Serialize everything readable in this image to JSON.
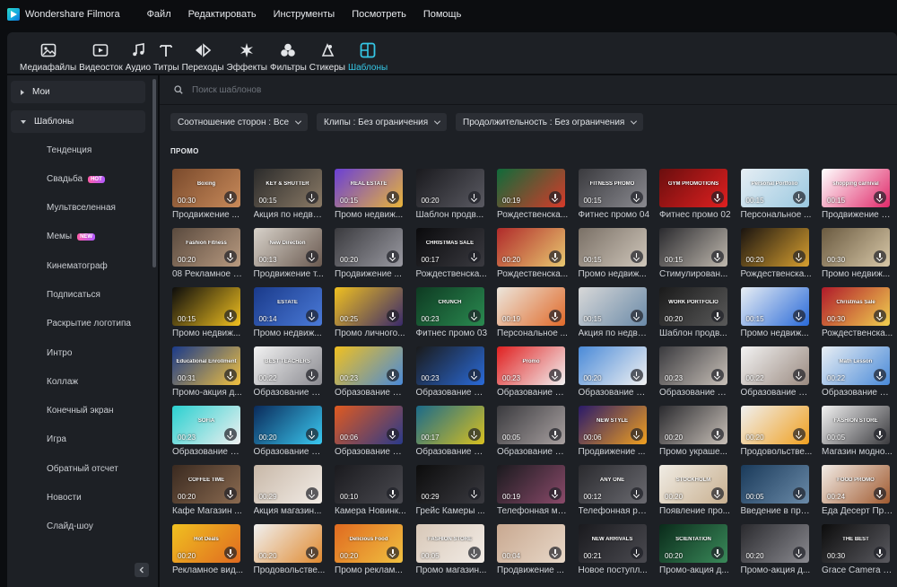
{
  "app": {
    "title": "Wondershare Filmora",
    "menu": [
      "Файл",
      "Редактировать",
      "Инструменты",
      "Посмотреть",
      "Помощь"
    ]
  },
  "toolbar": {
    "items": [
      {
        "label": "Медиафайлы",
        "icon": "media-icon"
      },
      {
        "label": "Видеосток",
        "icon": "stock-video-icon"
      },
      {
        "label": "Аудио",
        "icon": "music-note-icon"
      },
      {
        "label": "Титры",
        "icon": "titles-icon"
      },
      {
        "label": "Переходы",
        "icon": "transitions-icon"
      },
      {
        "label": "Эффекты",
        "icon": "effects-icon"
      },
      {
        "label": "Фильтры",
        "icon": "filters-icon"
      },
      {
        "label": "Стикеры",
        "icon": "stickers-icon"
      },
      {
        "label": "Шаблоны",
        "icon": "templates-icon",
        "active": true
      }
    ],
    "active_color": "#35c7e6"
  },
  "sidebar": {
    "groups": [
      {
        "label": "Мои",
        "expanded": false
      },
      {
        "label": "Шаблоны",
        "expanded": true
      }
    ],
    "items": [
      {
        "label": "Тенденция"
      },
      {
        "label": "Свадьба",
        "badge": "HOT"
      },
      {
        "label": "Мультвселенная"
      },
      {
        "label": "Мемы",
        "badge": "NEW"
      },
      {
        "label": "Кинематограф"
      },
      {
        "label": "Подписаться"
      },
      {
        "label": "Раскрытие логотипа"
      },
      {
        "label": "Интро"
      },
      {
        "label": "Коллаж"
      },
      {
        "label": "Конечный экран"
      },
      {
        "label": "Игра"
      },
      {
        "label": "Обратный отсчет"
      },
      {
        "label": "Новости"
      },
      {
        "label": "Слайд-шоу"
      }
    ]
  },
  "search": {
    "placeholder": "Поиск шаблонов",
    "value": ""
  },
  "filters": [
    {
      "label": "Соотношение сторон : Все"
    },
    {
      "label": "Клипы : Без ограничения"
    },
    {
      "label": "Продолжительность : Без ограничения"
    }
  ],
  "section_title": "ПРОМО",
  "templates": [
    {
      "name": "Продвижение ...",
      "duration": "00:30",
      "caption": "Boxing",
      "bg": [
        "#7a4a2c",
        "#c88a5a"
      ]
    },
    {
      "name": "Акция по недви...",
      "duration": "00:15",
      "caption": "KEY & SHUTTER",
      "bg": [
        "#2b2b2b",
        "#8a7a66"
      ]
    },
    {
      "name": "Промо недвиж...",
      "duration": "00:15",
      "caption": "REAL ESTATE",
      "bg": [
        "#6a3fd6",
        "#e8b43a"
      ]
    },
    {
      "name": "Шаблон продв...",
      "duration": "00:20",
      "caption": "",
      "bg": [
        "#1a1a1e",
        "#5a5a62"
      ]
    },
    {
      "name": "Рождественска...",
      "duration": "00:19",
      "caption": "",
      "bg": [
        "#0f6b3a",
        "#d63a2a"
      ]
    },
    {
      "name": "Фитнес промо 04",
      "duration": "00:15",
      "caption": "FITNESS PROMO",
      "bg": [
        "#3a3a3e",
        "#8a8a90"
      ]
    },
    {
      "name": "Фитнес промо 02",
      "duration": "",
      "caption": "GYM PROMOTIONS",
      "bg": [
        "#6a0e0e",
        "#e02020"
      ]
    },
    {
      "name": "Персональное ...",
      "duration": "00:15",
      "caption": "Personal Portfolio",
      "bg": [
        "#e6eef4",
        "#9ac8e0"
      ]
    },
    {
      "name": "Продвижение д...",
      "duration": "00:15",
      "caption": "shopping carnival",
      "bg": [
        "#ffffff",
        "#e02a6a"
      ]
    },
    {
      "name": "08 Рекламное в...",
      "duration": "00:20",
      "caption": "Fashion Fitness",
      "bg": [
        "#5a4a3e",
        "#b89a80"
      ]
    },
    {
      "name": "Продвижение т...",
      "duration": "00:13",
      "caption": "New Direction",
      "bg": [
        "#d8d2ca",
        "#6a5a50"
      ]
    },
    {
      "name": "Продвижение ...",
      "duration": "00:20",
      "caption": "",
      "bg": [
        "#3a3a3e",
        "#9a9aa2"
      ]
    },
    {
      "name": "Рождественска...",
      "duration": "00:17",
      "caption": "CHRISTMAS SALE",
      "bg": [
        "#0a0a0c",
        "#3a3a40"
      ]
    },
    {
      "name": "Рождественска...",
      "duration": "00:20",
      "caption": "",
      "bg": [
        "#b02a2a",
        "#e8c870"
      ]
    },
    {
      "name": "Промо недвиж...",
      "duration": "00:15",
      "caption": "",
      "bg": [
        "#7a7066",
        "#cfc6ba"
      ]
    },
    {
      "name": "Стимулирован...",
      "duration": "00:15",
      "caption": "",
      "bg": [
        "#2a2a2e",
        "#bfb8ae"
      ]
    },
    {
      "name": "Рождественска...",
      "duration": "00:20",
      "caption": "",
      "bg": [
        "#1a1410",
        "#d8a030"
      ]
    },
    {
      "name": "Промо недвиж...",
      "duration": "00:30",
      "caption": "",
      "bg": [
        "#6a5a40",
        "#d8c8a8"
      ]
    },
    {
      "name": "Промо недвиж...",
      "duration": "00:15",
      "caption": "",
      "bg": [
        "#0c0c0c",
        "#f0c020"
      ]
    },
    {
      "name": "Промо недвиж...",
      "duration": "00:14",
      "caption": "ESTATE",
      "bg": [
        "#1a3a8a",
        "#4a7ad8"
      ]
    },
    {
      "name": "Промо личного...",
      "duration": "00:25",
      "caption": "",
      "bg": [
        "#f0c020",
        "#3a2a6a"
      ]
    },
    {
      "name": "Фитнес промо 03",
      "duration": "00:23",
      "caption": "CRUNCH",
      "bg": [
        "#0e3a22",
        "#2a8a50"
      ]
    },
    {
      "name": "Персональное ...",
      "duration": "00:19",
      "caption": "",
      "bg": [
        "#ece6dc",
        "#e06a2a"
      ]
    },
    {
      "name": "Акция по недви...",
      "duration": "00:15",
      "caption": "",
      "bg": [
        "#d8d8d8",
        "#6a8aa8"
      ]
    },
    {
      "name": "Шаблон продв...",
      "duration": "00:20",
      "caption": "WORK PORTFOLIO",
      "bg": [
        "#1a1a1a",
        "#5a5a5a"
      ]
    },
    {
      "name": "Промо недвиж...",
      "duration": "00:15",
      "caption": "",
      "bg": [
        "#e8eef4",
        "#2a6ad8"
      ]
    },
    {
      "name": "Рождественска...",
      "duration": "00:30",
      "caption": "Christmas Sale",
      "bg": [
        "#b01a2a",
        "#f0d050"
      ]
    },
    {
      "name": "Промо-акция д...",
      "duration": "00:31",
      "caption": "Educational Enrollment",
      "bg": [
        "#1a3a8a",
        "#f0c040"
      ]
    },
    {
      "name": "Образование П...",
      "duration": "00:22",
      "caption": "BEST TEACHERS",
      "bg": [
        "#f2f2f2",
        "#8a8a90"
      ]
    },
    {
      "name": "Образование П...",
      "duration": "00:23",
      "caption": "",
      "bg": [
        "#f0c020",
        "#4a8ad8"
      ]
    },
    {
      "name": "Образование П...",
      "duration": "00:23",
      "caption": "",
      "bg": [
        "#1a1a1a",
        "#2a6ad8"
      ]
    },
    {
      "name": "Образование П...",
      "duration": "00:23",
      "caption": "Promo",
      "bg": [
        "#e02020",
        "#f2f2f2"
      ]
    },
    {
      "name": "Образование П...",
      "duration": "00:20",
      "caption": "",
      "bg": [
        "#4a8ad8",
        "#f2f2f2"
      ]
    },
    {
      "name": "Образование П...",
      "duration": "00:23",
      "caption": "",
      "bg": [
        "#3a3a3e",
        "#c8c0b8"
      ]
    },
    {
      "name": "Образование П...",
      "duration": "00:22",
      "caption": "",
      "bg": [
        "#f2f2f2",
        "#9a8a80"
      ]
    },
    {
      "name": "Образование П...",
      "duration": "00:22",
      "caption": "Math Lesson",
      "bg": [
        "#e8eef4",
        "#4a8ad8"
      ]
    },
    {
      "name": "Образование П...",
      "duration": "00:23",
      "caption": "SOFIA",
      "bg": [
        "#2ad0d0",
        "#f0f0f0"
      ]
    },
    {
      "name": "Образование П...",
      "duration": "00:20",
      "caption": "",
      "bg": [
        "#0a2a5a",
        "#3ac8f0"
      ]
    },
    {
      "name": "Образование П...",
      "duration": "00:06",
      "caption": "",
      "bg": [
        "#e05a20",
        "#2a3a8a"
      ]
    },
    {
      "name": "Образование П...",
      "duration": "00:17",
      "caption": "",
      "bg": [
        "#1a6a8a",
        "#d8c020"
      ]
    },
    {
      "name": "Образование П...",
      "duration": "00:05",
      "caption": "",
      "bg": [
        "#3a3a3e",
        "#a8a0a0"
      ]
    },
    {
      "name": "Продвижение ...",
      "duration": "00:06",
      "caption": "NEW STYLE",
      "bg": [
        "#2a1a6a",
        "#f0a020"
      ]
    },
    {
      "name": "Промо украше...",
      "duration": "00:20",
      "caption": "",
      "bg": [
        "#2a2a2e",
        "#c8c0b8"
      ]
    },
    {
      "name": "Продовольстве...",
      "duration": "00:20",
      "caption": "",
      "bg": [
        "#f0f0f0",
        "#f0a020"
      ]
    },
    {
      "name": "Магазин модно...",
      "duration": "00:05",
      "caption": "FASHION STORE",
      "bg": [
        "#f2f2f2",
        "#3a3a3e"
      ]
    },
    {
      "name": "Кафе Магазин ...",
      "duration": "00:20",
      "caption": "COFFEE TIME",
      "bg": [
        "#3a2a20",
        "#8a6a50"
      ]
    },
    {
      "name": "Акция магазин...",
      "duration": "00:29",
      "caption": "",
      "bg": [
        "#c8b8a8",
        "#f2ece6"
      ]
    },
    {
      "name": "Камера Новинк...",
      "duration": "00:10",
      "caption": "",
      "bg": [
        "#1a1a1e",
        "#4a4a50"
      ]
    },
    {
      "name": "Грейс Камеры ...",
      "duration": "00:29",
      "caption": "",
      "bg": [
        "#0c0c0c",
        "#3a3a40"
      ]
    },
    {
      "name": "Телефонная ма...",
      "duration": "00:19",
      "caption": "",
      "bg": [
        "#1a1a1e",
        "#8a4a6a"
      ]
    },
    {
      "name": "Телефонная ре...",
      "duration": "00:12",
      "caption": "ANY ONE",
      "bg": [
        "#2a2a2e",
        "#6a6a70"
      ]
    },
    {
      "name": "Появление про...",
      "duration": "00:20",
      "caption": "STOCKHOLM",
      "bg": [
        "#f0ece4",
        "#c8b090"
      ]
    },
    {
      "name": "Введение в про...",
      "duration": "00:05",
      "caption": "",
      "bg": [
        "#1a3a5a",
        "#6a8aa8"
      ]
    },
    {
      "name": "Еда Десерт Про...",
      "duration": "00:24",
      "caption": "FOOD PROMO",
      "bg": [
        "#f2ece6",
        "#a05a30"
      ]
    },
    {
      "name": "Рекламное вид...",
      "duration": "00:20",
      "caption": "Hot Deals",
      "bg": [
        "#f0c020",
        "#e06a20"
      ]
    },
    {
      "name": "Продовольстве...",
      "duration": "00:20",
      "caption": "",
      "bg": [
        "#f0f0f0",
        "#e08a30"
      ]
    },
    {
      "name": "Промо реклам...",
      "duration": "00:20",
      "caption": "Delicious Food",
      "bg": [
        "#e06a20",
        "#f0c040"
      ]
    },
    {
      "name": "Промо магазин...",
      "duration": "00:05",
      "caption": "FASHION STORE",
      "bg": [
        "#d8c8b8",
        "#f2ece6"
      ]
    },
    {
      "name": "Продвижение ...",
      "duration": "00:04",
      "caption": "",
      "bg": [
        "#c8a890",
        "#e8d8c8"
      ]
    },
    {
      "name": "Новое поступл...",
      "duration": "00:21",
      "caption": "NEW ARRIVALS",
      "bg": [
        "#1a1a1e",
        "#4a4a50"
      ]
    },
    {
      "name": "Промо-акция д...",
      "duration": "00:20",
      "caption": "SCIENTATION",
      "bg": [
        "#0a2a1a",
        "#3a8a5a"
      ]
    },
    {
      "name": "Промо-акция д...",
      "duration": "00:20",
      "caption": "",
      "bg": [
        "#2a2a2e",
        "#8a8a90"
      ]
    },
    {
      "name": "Grace Camera P...",
      "duration": "00:30",
      "caption": "THE BEST",
      "bg": [
        "#0c0c0c",
        "#5a5a60"
      ]
    }
  ]
}
